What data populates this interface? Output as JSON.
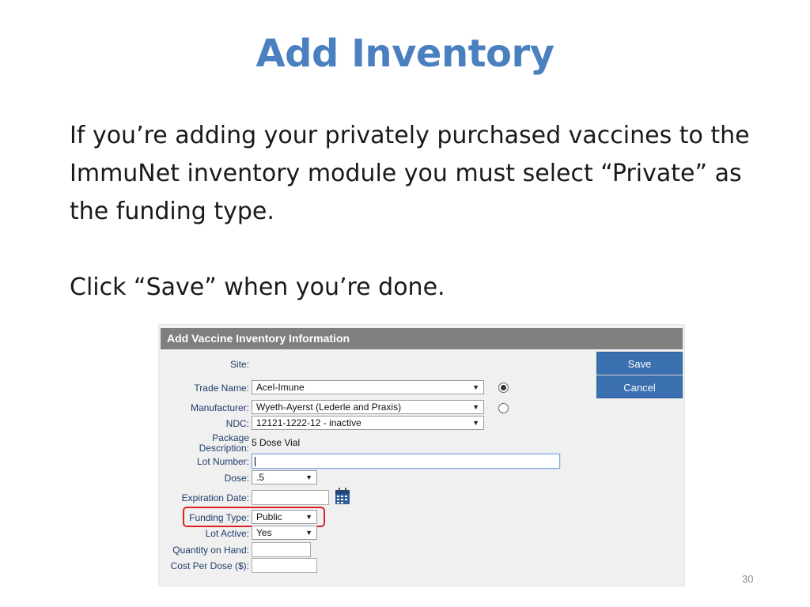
{
  "slide": {
    "title": "Add Inventory",
    "paragraph1": "If you’re adding your privately purchased vaccines to the ImmuNet inventory module you must select “Private” as the funding type.",
    "paragraph2": "Click “Save” when you’re done.",
    "page_number": "30"
  },
  "form": {
    "header": "Add Vaccine Inventory Information",
    "site_label": "Site:",
    "trade_name_label": "Trade Name:",
    "trade_name_value": "Acel-Imune",
    "manufacturer_label": "Manufacturer:",
    "manufacturer_value": "Wyeth-Ayerst (Lederle and Praxis)",
    "ndc_label": "NDC:",
    "ndc_value": "12121-1222-12 - inactive",
    "package_label_1": "Package",
    "package_label_2": "Description:",
    "package_value": "5 Dose Vial",
    "lot_number_label": "Lot Number:",
    "dose_label": "Dose:",
    "dose_value": ".5",
    "expiration_label": "Expiration Date:",
    "funding_label": "Funding Type:",
    "funding_value": "Public",
    "lot_active_label": "Lot Active:",
    "lot_active_value": "Yes",
    "quantity_label": "Quantity on Hand:",
    "cost_label": "Cost Per Dose ($):",
    "save_label": "Save",
    "cancel_label": "Cancel",
    "trade_name_radio_selected": true,
    "manufacturer_radio_selected": false
  },
  "icons": {
    "dropdown": "chevron-down-icon",
    "calendar": "calendar-icon"
  },
  "colors": {
    "title": "#4a80c0",
    "header_bar": "#7f7f7f",
    "button": "#3a6fb0",
    "highlight": "#e02020"
  }
}
